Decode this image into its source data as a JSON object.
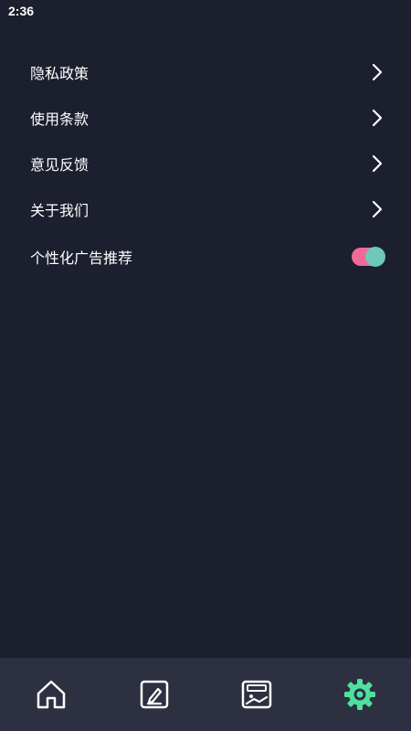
{
  "status_bar": {
    "time": "2:36"
  },
  "menu": {
    "items": [
      {
        "label": "隐私政策",
        "icon": "chevron-right-icon"
      },
      {
        "label": "使用条款",
        "icon": "chevron-right-icon"
      },
      {
        "label": "意见反馈",
        "icon": "chevron-right-icon"
      },
      {
        "label": "关于我们",
        "icon": "chevron-right-icon"
      }
    ],
    "toggle": {
      "label": "个性化广告推荐",
      "state": "on"
    }
  },
  "bottom_nav": {
    "items": [
      {
        "icon": "home-icon",
        "active": false
      },
      {
        "icon": "edit-icon",
        "active": false
      },
      {
        "icon": "gallery-icon",
        "active": false
      },
      {
        "icon": "settings-gear-icon",
        "active": true
      }
    ]
  },
  "colors": {
    "background": "#1b1f2e",
    "nav_background": "#2c3040",
    "accent": "#4fe0a0",
    "toggle_track": "#ef6b97",
    "toggle_knob": "#6ec7b8"
  }
}
